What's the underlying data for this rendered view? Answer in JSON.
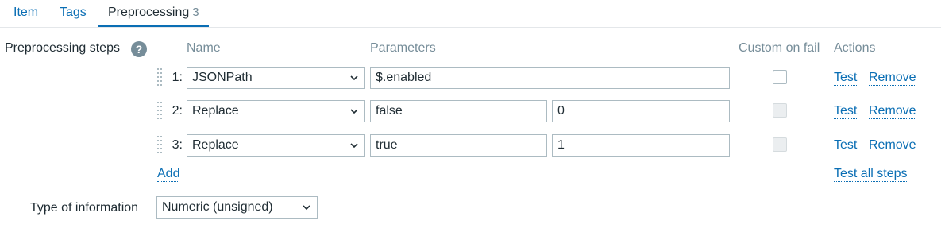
{
  "tabs": {
    "item": "Item",
    "tags": "Tags",
    "preprocessing": "Preprocessing",
    "preprocessing_count": "3"
  },
  "form": {
    "preprocessing_label": "Preprocessing steps",
    "help": "?",
    "type_label": "Type of information",
    "type_value": "Numeric (unsigned)"
  },
  "columns": {
    "name": "Name",
    "parameters": "Parameters",
    "custom_on_fail": "Custom on fail",
    "actions": "Actions"
  },
  "steps": [
    {
      "num": "1:",
      "name": "JSONPath",
      "param1": "$.enabled",
      "custom_on_fail": false,
      "custom_on_fail_enabled": true
    },
    {
      "num": "2:",
      "name": "Replace",
      "param1": "false",
      "param2": "0",
      "custom_on_fail": false,
      "custom_on_fail_enabled": false
    },
    {
      "num": "3:",
      "name": "Replace",
      "param1": "true",
      "param2": "1",
      "custom_on_fail": false,
      "custom_on_fail_enabled": false
    }
  ],
  "actions": {
    "test": "Test",
    "remove": "Remove",
    "add": "Add",
    "test_all": "Test all steps"
  },
  "icons": {
    "chevron": "chevron-down-icon",
    "drag": "drag-handle-icon",
    "help": "help-icon"
  },
  "colors": {
    "link": "#0a6eb4",
    "text": "#1f2c33",
    "muted": "#768d99",
    "border": "#acbbc2"
  }
}
